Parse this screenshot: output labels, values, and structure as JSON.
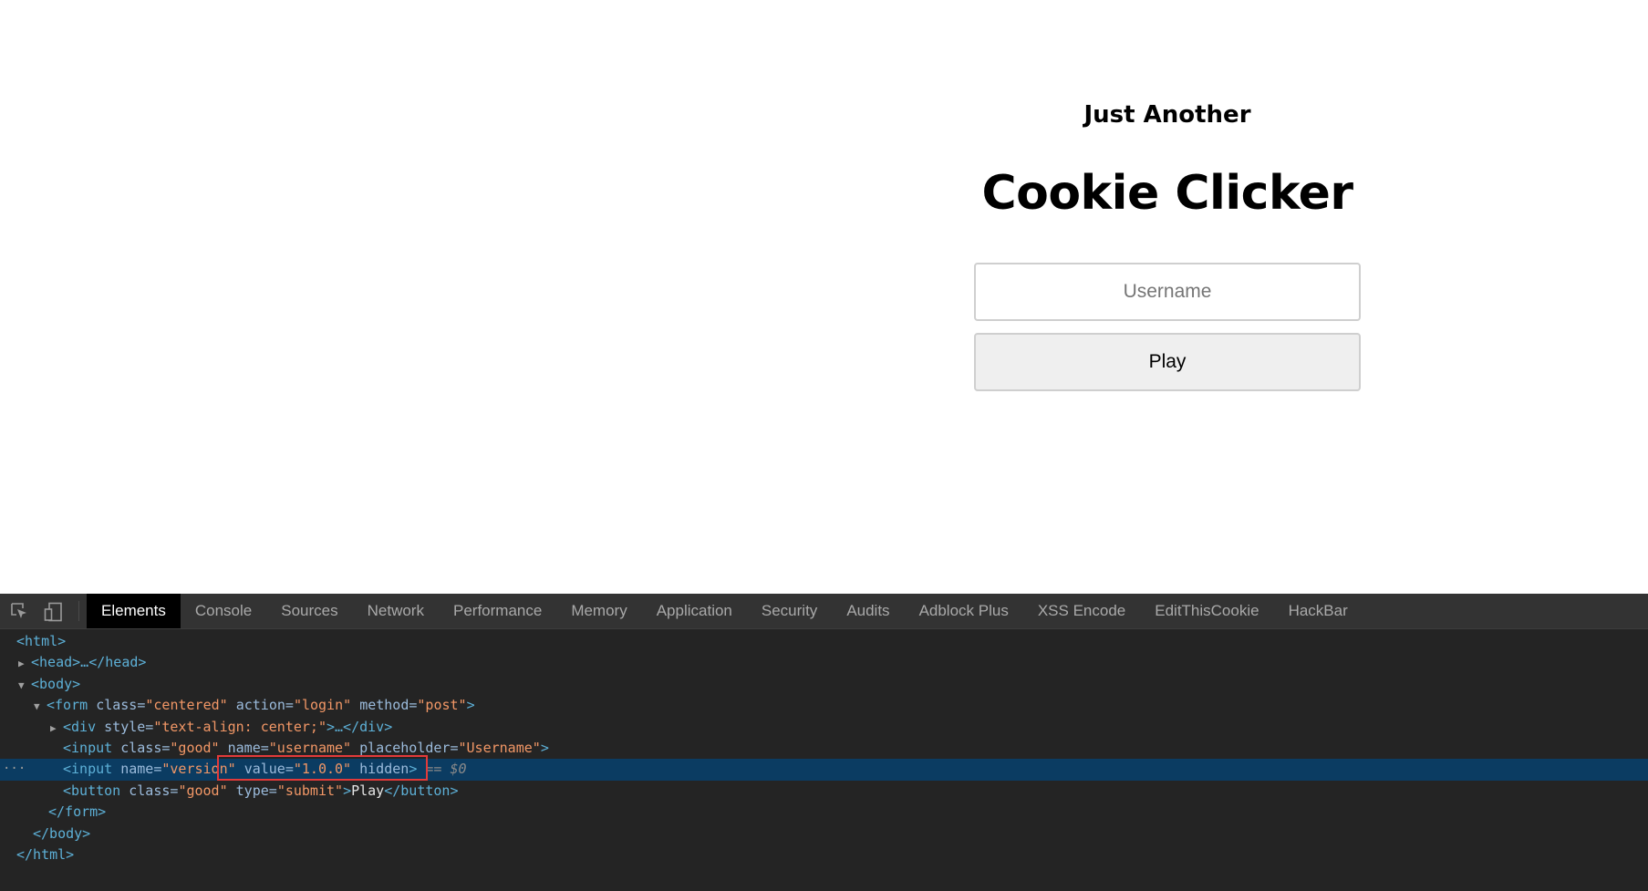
{
  "page": {
    "subtitle": "Just Another",
    "title": "Cookie Clicker",
    "username_placeholder": "Username",
    "play_label": "Play"
  },
  "devtools": {
    "icons": [
      "inspect-element-icon",
      "device-toolbar-icon"
    ],
    "tabs": [
      "Elements",
      "Console",
      "Sources",
      "Network",
      "Performance",
      "Memory",
      "Application",
      "Security",
      "Audits",
      "Adblock Plus",
      "XSS Encode",
      "EditThisCookie",
      "HackBar"
    ],
    "active_tab": "Elements",
    "tree": {
      "l1_html_open": "<html>",
      "l2_head": "<head>…</head>",
      "l3_body_open": "<body>",
      "l4_form_tag": "<form",
      "l4_class_attr": "class=",
      "l4_class_val": "\"centered\"",
      "l4_action_attr": "action=",
      "l4_action_val": "\"login\"",
      "l4_method_attr": "method=",
      "l4_method_val": "\"post\"",
      "l4_close": ">",
      "l5_div_tag": "<div",
      "l5_style_attr": "style=",
      "l5_style_val": "\"text-align: center;\"",
      "l5_close": ">…</div>",
      "l6_input_tag": "<input",
      "l6_class_attr": "class=",
      "l6_class_val": "\"good\"",
      "l6_name_attr": "name=",
      "l6_name_val": "\"username\"",
      "l6_ph_attr": "placeholder=",
      "l6_ph_val": "\"Username\"",
      "l6_close": ">",
      "l7_input_tag": "<input",
      "l7_name_attr": "name=",
      "l7_name_val": "\"version\"",
      "l7_value_attr": "value=",
      "l7_value_val": "\"1.0.0\"",
      "l7_hidden": "hidden",
      "l7_close": ">",
      "l7_marker": "== $0",
      "l7_dots": "···",
      "l8_button_tag": "<button",
      "l8_class_attr": "class=",
      "l8_class_val": "\"good\"",
      "l8_type_attr": "type=",
      "l8_type_val": "\"submit\"",
      "l8_gt": ">",
      "l8_text": "Play",
      "l8_end": "</button>",
      "l9_form_close": "</form>",
      "l10_body_close": "</body>",
      "l11_html_close": "</html>"
    }
  },
  "colors": {
    "devtools_bg": "#242424",
    "toolbar_bg": "#333333",
    "selected_row": "#0b3c62",
    "tag_color": "#5db0d7",
    "attr_value_color": "#f29766",
    "highlight_box": "#e23a3a"
  }
}
